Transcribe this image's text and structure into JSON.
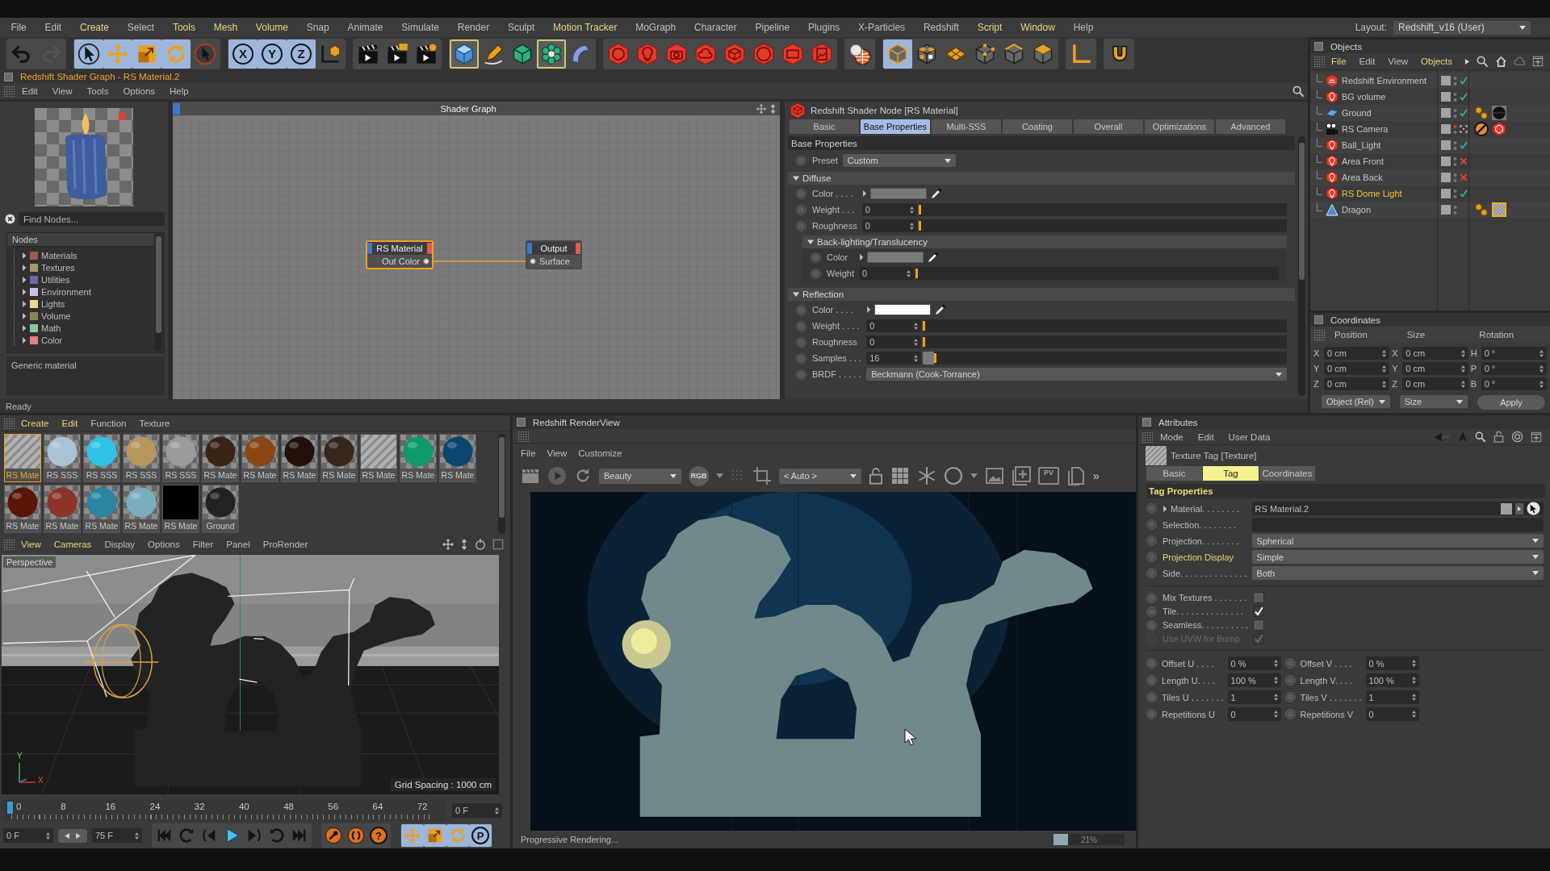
{
  "menu_bar": {
    "items": [
      {
        "label": "File",
        "highlighted": false
      },
      {
        "label": "Edit",
        "highlighted": false
      },
      {
        "label": "Create",
        "highlighted": true
      },
      {
        "label": "Select",
        "highlighted": false
      },
      {
        "label": "Tools",
        "highlighted": true
      },
      {
        "label": "Mesh",
        "highlighted": true
      },
      {
        "label": "Volume",
        "highlighted": true
      },
      {
        "label": "Snap",
        "highlighted": false
      },
      {
        "label": "Animate",
        "highlighted": false
      },
      {
        "label": "Simulate",
        "highlighted": false
      },
      {
        "label": "Render",
        "highlighted": false
      },
      {
        "label": "Sculpt",
        "highlighted": false
      },
      {
        "label": "Motion Tracker",
        "highlighted": true
      },
      {
        "label": "MoGraph",
        "highlighted": false
      },
      {
        "label": "Character",
        "highlighted": false
      },
      {
        "label": "Pipeline",
        "highlighted": false
      },
      {
        "label": "Plugins",
        "highlighted": false
      },
      {
        "label": "X-Particles",
        "highlighted": false
      },
      {
        "label": "Redshift",
        "highlighted": false
      },
      {
        "label": "Script",
        "highlighted": true
      },
      {
        "label": "Window",
        "highlighted": true
      },
      {
        "label": "Help",
        "highlighted": false
      }
    ],
    "layout_label": "Layout:",
    "layout_value": "Redshift_v16 (User)"
  },
  "toolbar": {
    "groups": [
      {
        "buttons": [
          {
            "selected": false,
            "highlighted": false,
            "disabled": false
          },
          {
            "selected": false,
            "highlighted": false,
            "disabled": true
          }
        ]
      },
      {
        "buttons": [
          {
            "selected": true,
            "highlighted": false,
            "disabled": false
          },
          {
            "selected": true,
            "highlighted": false,
            "disabled": false
          },
          {
            "selected": true,
            "highlighted": false,
            "disabled": false
          },
          {
            "selected": true,
            "highlighted": false,
            "disabled": false
          },
          {
            "selected": false,
            "highlighted": false,
            "disabled": false
          }
        ]
      },
      {
        "buttons": [
          {
            "label": "X",
            "selected": true,
            "highlighted": false,
            "disabled": false
          },
          {
            "label": "Y",
            "selected": true,
            "highlighted": false,
            "disabled": false
          },
          {
            "label": "Z",
            "selected": true,
            "highlighted": false,
            "disabled": false
          },
          {
            "selected": false,
            "highlighted": false,
            "disabled": false
          }
        ]
      },
      {
        "buttons": [
          {
            "selected": false,
            "highlighted": false,
            "disabled": false
          },
          {
            "selected": false,
            "highlighted": false,
            "disabled": false
          },
          {
            "selected": false,
            "highlighted": false,
            "disabled": false
          }
        ]
      },
      {
        "buttons": [
          {
            "selected": false,
            "highlighted": true,
            "disabled": false
          },
          {
            "selected": false,
            "highlighted": false,
            "disabled": false
          },
          {
            "selected": false,
            "highlighted": false,
            "disabled": false
          },
          {
            "selected": false,
            "highlighted": true,
            "disabled": false
          },
          {
            "selected": false,
            "highlighted": false,
            "disabled": false
          }
        ]
      },
      {
        "buttons": [
          {
            "selected": false,
            "highlighted": false,
            "disabled": false
          },
          {
            "selected": false,
            "highlighted": false,
            "disabled": false
          },
          {
            "selected": false,
            "highlighted": false,
            "disabled": false
          },
          {
            "selected": false,
            "highlighted": false,
            "disabled": false
          },
          {
            "selected": false,
            "highlighted": false,
            "disabled": false
          },
          {
            "selected": false,
            "highlighted": false,
            "disabled": false
          },
          {
            "selected": false,
            "highlighted": false,
            "disabled": false
          },
          {
            "selected": false,
            "highlighted": false,
            "disabled": false
          }
        ]
      },
      {
        "buttons": [
          {
            "selected": false,
            "highlighted": false,
            "disabled": false
          }
        ]
      },
      {
        "buttons": [
          {
            "selected": true,
            "highlighted": false,
            "disabled": false
          },
          {
            "selected": false,
            "highlighted": false,
            "disabled": false
          },
          {
            "selected": false,
            "highlighted": false,
            "disabled": false
          },
          {
            "selected": false,
            "highlighted": false,
            "disabled": false
          },
          {
            "selected": false,
            "highlighted": false,
            "disabled": false
          },
          {
            "selected": false,
            "highlighted": false,
            "disabled": false
          }
        ]
      },
      {
        "buttons": [
          {
            "selected": false,
            "highlighted": false,
            "disabled": false
          }
        ]
      },
      {
        "buttons": [
          {
            "selected": false,
            "highlighted": false,
            "disabled": false
          }
        ]
      }
    ]
  },
  "shader_graph": {
    "title": "Redshift Shader Graph - RS Material.2",
    "menu": [
      "Edit",
      "View",
      "Tools",
      "Options",
      "Help"
    ],
    "find_placeholder": "Find Nodes...",
    "nodes_header": "Nodes",
    "node_categories": [
      {
        "label": "Materials",
        "color": "#a05a50"
      },
      {
        "label": "Textures",
        "color": "#a89868"
      },
      {
        "label": "Utilities",
        "color": "#6a6aa8"
      },
      {
        "label": "Environment",
        "color": "#d0c0e0"
      },
      {
        "label": "Lights",
        "color": "#f0d890"
      },
      {
        "label": "Volume",
        "color": "#8a8450"
      },
      {
        "label": "Math",
        "color": "#88c8a0"
      },
      {
        "label": "Color",
        "color": "#e08080"
      }
    ],
    "description": "Generic material",
    "canvas_title": "Shader Graph",
    "nodes": [
      {
        "title": "RS Material",
        "port": "Out Color",
        "kind": "material",
        "selected": true
      },
      {
        "title": "Output",
        "port": "Surface",
        "kind": "output",
        "selected": false
      }
    ]
  },
  "shader_node": {
    "title": "Redshift Shader Node [RS Material]",
    "tabs": [
      {
        "label": "Basic",
        "selected": false
      },
      {
        "label": "Base Properties",
        "selected": true
      },
      {
        "label": "Multi-SSS",
        "selected": false
      },
      {
        "label": "Coating",
        "selected": false
      },
      {
        "label": "Overall",
        "selected": false
      },
      {
        "label": "Optimizations",
        "selected": false
      },
      {
        "label": "Advanced",
        "selected": false
      }
    ],
    "section": "Base Properties",
    "preset": {
      "label": "Preset",
      "value": "Custom"
    },
    "groups": [
      {
        "title": "Diffuse",
        "expanded": true,
        "rows": [
          {
            "kind": "color",
            "label": "Color . . . .",
            "color": "#7a7a7a"
          },
          {
            "kind": "slider",
            "label": "Weight . . .",
            "value": "0",
            "level": 0
          },
          {
            "kind": "slider",
            "label": "Roughness",
            "value": "0",
            "level": 0
          },
          {
            "kind": "group",
            "title": "Back-lighting/Translucency",
            "expanded": true,
            "rows": [
              {
                "kind": "color",
                "label": "Color",
                "color": "#7a7a7a"
              },
              {
                "kind": "slider",
                "label": "Weight",
                "value": "0",
                "level": 0
              }
            ]
          }
        ]
      },
      {
        "title": "Reflection",
        "expanded": true,
        "rows": [
          {
            "kind": "color",
            "label": "Color . . . .",
            "color": "#ffffff"
          },
          {
            "kind": "slider",
            "label": "Weight . . . .",
            "value": "0",
            "level": 0
          },
          {
            "kind": "slider",
            "label": "Roughness",
            "value": "0",
            "level": 0
          },
          {
            "kind": "slider",
            "label": "Samples . . .",
            "value": "16",
            "level": 0.03
          },
          {
            "kind": "dropdown",
            "label": "BRDF . . . . .",
            "value": "Beckmann (Cook-Torrance)"
          }
        ]
      }
    ]
  },
  "status_bar": "Ready",
  "objects": {
    "title": "Objects",
    "menu": [
      {
        "label": "File",
        "highlighted": true
      },
      {
        "label": "Edit",
        "highlighted": false
      },
      {
        "label": "View",
        "highlighted": false
      },
      {
        "label": "Objects",
        "highlighted": true
      }
    ],
    "items": [
      {
        "name": "Redshift Environment",
        "kind": "environment",
        "highlighted": false,
        "editor_visible": true,
        "enabled": true
      },
      {
        "name": "BG volume",
        "kind": "light",
        "highlighted": false,
        "editor_visible": true,
        "enabled": true
      },
      {
        "name": "Ground",
        "kind": "plane",
        "highlighted": false,
        "editor_visible": true,
        "enabled": true,
        "tags": [
          {
            "kind": "phong",
            "selected": false
          },
          {
            "kind": "material",
            "selected": false
          }
        ]
      },
      {
        "name": "RS Camera",
        "kind": "camera",
        "highlighted": false,
        "editor_visible": false,
        "tags": [
          {
            "kind": "protection",
            "selected": false
          },
          {
            "kind": "redshift",
            "selected": false
          }
        ]
      },
      {
        "name": "Ball_Light",
        "kind": "light",
        "highlighted": false,
        "editor_visible": true,
        "enabled": true
      },
      {
        "name": "Area Front",
        "kind": "light",
        "highlighted": false,
        "editor_visible": true,
        "enabled": false
      },
      {
        "name": "Area Back",
        "kind": "light",
        "highlighted": false,
        "editor_visible": true,
        "enabled": false
      },
      {
        "name": "RS Dome Light",
        "kind": "light",
        "highlighted": true,
        "editor_visible": true,
        "enabled": true
      },
      {
        "name": "Dragon",
        "kind": "polygon",
        "highlighted": false,
        "editor_visible": true,
        "tags": [
          {
            "kind": "phong",
            "selected": false
          },
          {
            "kind": "texture",
            "selected": true
          }
        ]
      }
    ]
  },
  "coordinates": {
    "title": "Coordinates",
    "columns": [
      {
        "heading": "Position",
        "axes": [
          "X",
          "Y",
          "Z"
        ],
        "values": [
          "0 cm",
          "0 cm",
          "0 cm"
        ]
      },
      {
        "heading": "Size",
        "axes": [
          "X",
          "Y",
          "Z"
        ],
        "values": [
          "0 cm",
          "0 cm",
          "0 cm"
        ]
      },
      {
        "heading": "Rotation",
        "axes": [
          "H",
          "P",
          "B"
        ],
        "values": [
          "0 °",
          "0 °",
          "0 °"
        ]
      }
    ],
    "mode": "Object (Rel)",
    "size_mode": "Size",
    "apply": "Apply"
  },
  "materials": {
    "menu": [
      {
        "label": "Create",
        "highlighted": true
      },
      {
        "label": "Edit",
        "highlighted": true
      },
      {
        "label": "Function",
        "highlighted": false
      },
      {
        "label": "Texture",
        "highlighted": false
      }
    ],
    "items": [
      {
        "label": "RS Mate",
        "kind": "striped",
        "selected": true
      },
      {
        "label": "RS SSS",
        "kind": "sphere",
        "color": "#a9c2d6",
        "selected": false
      },
      {
        "label": "RS SSS",
        "kind": "sphere",
        "color": "#2ec2e6",
        "selected": false
      },
      {
        "label": "RS SSS",
        "kind": "sphere",
        "color": "#b8975e",
        "selected": false
      },
      {
        "label": "RS SSS",
        "kind": "sphere",
        "color": "#9c9c9c",
        "selected": false
      },
      {
        "label": "RS Mate",
        "kind": "sphere",
        "color": "#3a2416",
        "selected": false
      },
      {
        "label": "RS Mate",
        "kind": "sphere",
        "color": "#8a4614",
        "selected": false
      },
      {
        "label": "RS Mate",
        "kind": "sphere",
        "color": "#22110a",
        "selected": false
      },
      {
        "label": "RS Mate",
        "kind": "sphere",
        "color": "#37261a",
        "selected": false
      },
      {
        "label": "RS Mate",
        "kind": "striped",
        "selected": false
      },
      {
        "label": "RS Mate",
        "kind": "sphere",
        "color": "#0f9a6c",
        "selected": false
      },
      {
        "label": "RS Mate",
        "kind": "sphere",
        "color": "#0b4670",
        "selected": false
      },
      {
        "label": "RS Mate",
        "kind": "sphere",
        "color": "#5a1608",
        "selected": false
      },
      {
        "label": "RS Mate",
        "kind": "sphere",
        "color": "#8c3428",
        "selected": false
      },
      {
        "label": "RS Mate",
        "kind": "sphere",
        "color": "#2a86a2",
        "selected": false
      },
      {
        "label": "RS Mate",
        "kind": "sphere",
        "color": "#78aebe",
        "selected": false
      },
      {
        "label": "RS Mate",
        "kind": "flat",
        "color": "#000000",
        "selected": false
      },
      {
        "label": "Ground",
        "kind": "sphere",
        "color": "#222222",
        "selected": false
      }
    ]
  },
  "viewport": {
    "menu": [
      {
        "label": "View",
        "highlighted": true
      },
      {
        "label": "Cameras",
        "highlighted": true
      },
      {
        "label": "Display",
        "highlighted": false
      },
      {
        "label": "Options",
        "highlighted": false
      },
      {
        "label": "Filter",
        "highlighted": false
      },
      {
        "label": "Panel",
        "highlighted": false
      },
      {
        "label": "ProRender",
        "highlighted": false
      }
    ],
    "camera": "Perspective",
    "grid_spacing": "Grid Spacing : 1000 cm",
    "axis_labels": [
      "Y",
      "X"
    ]
  },
  "timeline": {
    "ticks": [
      "0",
      "8",
      "16",
      "24",
      "32",
      "40",
      "48",
      "56",
      "64",
      "72"
    ],
    "level": 0,
    "current": "0 F"
  },
  "transport": {
    "start": "0 F",
    "end": "75 F",
    "groups": [
      {
        "buttons": [
          {
            "selected": false
          },
          {
            "selected": false
          },
          {
            "selected": false
          },
          {
            "selected": false
          },
          {
            "selected": false
          },
          {
            "selected": false
          },
          {
            "selected": false
          }
        ]
      },
      {
        "buttons": [
          {
            "selected": false
          },
          {
            "selected": false
          },
          {
            "label": "?",
            "selected": false
          }
        ]
      },
      {
        "buttons": [
          {
            "selected": true
          },
          {
            "selected": true
          },
          {
            "selected": true
          },
          {
            "label": "P",
            "selected": true
          }
        ]
      }
    ]
  },
  "render_view": {
    "title": "Redshift RenderView",
    "menu": [
      "File",
      "View",
      "Customize"
    ],
    "aov": "Beauty",
    "channel": "RGB",
    "zoom": "< Auto >",
    "pv": "PV",
    "more": "»",
    "status": "Progressive Rendering...",
    "progress": {
      "level": 0.21,
      "reading": "21%"
    }
  },
  "attributes": {
    "title": "Attributes",
    "menu": [
      "Mode",
      "Edit",
      "User Data"
    ],
    "object": "Texture Tag [Texture]",
    "tabs": [
      {
        "label": "Basic",
        "selected": false
      },
      {
        "label": "Tag",
        "selected": true
      },
      {
        "label": "Coordinates",
        "selected": false
      }
    ],
    "section": "Tag Properties",
    "fields": [
      {
        "kind": "link",
        "label": "Material. . . . . . . .",
        "value": "RS Material.2",
        "highlighted": false
      },
      {
        "kind": "text",
        "label": "Selection. . . . . . . .",
        "highlighted": false
      },
      {
        "kind": "dropdown",
        "label": "Projection. . . . . . . .",
        "value": "Spherical",
        "highlighted": false
      },
      {
        "kind": "dropdown",
        "label": "Projection Display",
        "value": "Simple",
        "highlighted": true
      },
      {
        "kind": "dropdown",
        "label": "Side. . . . . . . . . . . . . .",
        "value": "Both",
        "highlighted": false
      }
    ],
    "checkboxes": [
      {
        "label": "Mix Textures . . . . . . .",
        "checked": false,
        "disabled": false
      },
      {
        "label": "Tile. . . . . . . . . . . . . .",
        "checked": true,
        "disabled": false
      },
      {
        "label": "Seamless. . . . . . . . . .",
        "checked": false,
        "disabled": false
      },
      {
        "label": "Use UVW for Bump",
        "checked": true,
        "disabled": true
      }
    ],
    "pairs": [
      {
        "left": {
          "label": "Offset U . . . .",
          "value": "0 %"
        },
        "right": {
          "label": "Offset V . . . .",
          "value": "0 %"
        }
      },
      {
        "left": {
          "label": "Length U. . . .",
          "value": "100 %"
        },
        "right": {
          "label": "Length V. . . .",
          "value": "100 %"
        }
      },
      {
        "left": {
          "label": "Tiles U . . . . . . .",
          "value": "1"
        },
        "right": {
          "label": "Tiles V . . . . . . .",
          "value": "1"
        }
      },
      {
        "left": {
          "label": "Repetitions U",
          "value": "0"
        },
        "right": {
          "label": "Repetitions V",
          "value": "0"
        }
      }
    ]
  }
}
